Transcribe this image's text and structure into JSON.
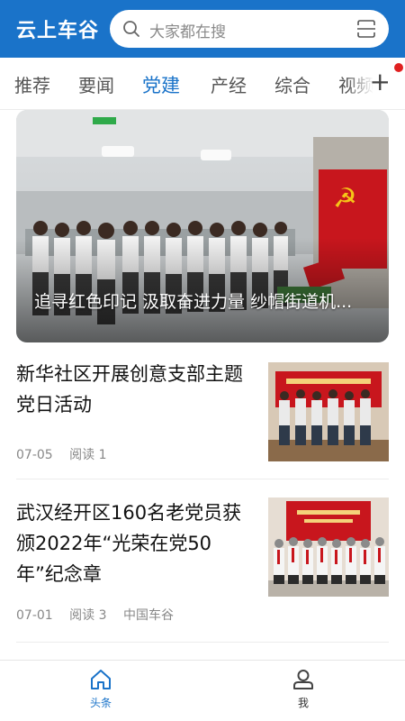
{
  "header": {
    "app_title": "云上车谷",
    "search_placeholder": "大家都在搜",
    "search_icon": "search-icon",
    "scan_icon": "scan-icon"
  },
  "tabs": [
    {
      "label": "推荐",
      "active": false
    },
    {
      "label": "要闻",
      "active": false
    },
    {
      "label": "党建",
      "active": true
    },
    {
      "label": "产经",
      "active": false
    },
    {
      "label": "综合",
      "active": false
    },
    {
      "label": "视频",
      "active": false
    }
  ],
  "tab_add_label": "+",
  "hero": {
    "caption": "追寻红色印记 汲取奋进力量 纱帽街道机..."
  },
  "articles": [
    {
      "title": "新华社区开展创意支部主题党日活动",
      "date": "07-05",
      "reads": "阅读 1",
      "source": ""
    },
    {
      "title": "武汉经开区160名老党员获颁2022年“光荣在党50年”纪念章",
      "date": "07-01",
      "reads": "阅读 3",
      "source": "中国车谷"
    }
  ],
  "bottom_nav": [
    {
      "label": "头条",
      "icon": "home-icon",
      "active": true
    },
    {
      "label": "我",
      "icon": "profile-icon",
      "active": false
    }
  ],
  "colors": {
    "brand": "#1a73c9",
    "party_red": "#c8161d",
    "notification": "#e02020"
  }
}
